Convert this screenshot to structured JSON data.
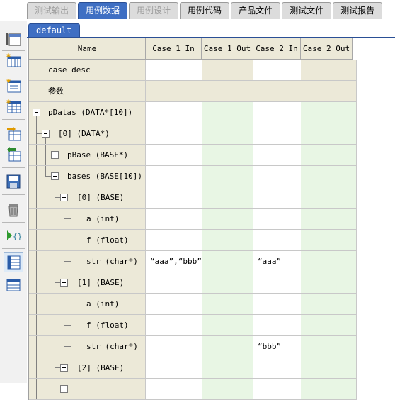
{
  "tabs": [
    {
      "label": "测试输出",
      "state": "disabled"
    },
    {
      "label": "用例数据",
      "state": "active"
    },
    {
      "label": "用例设计",
      "state": "disabled"
    },
    {
      "label": "用例代码",
      "state": "normal"
    },
    {
      "label": "产品文件",
      "state": "normal"
    },
    {
      "label": "测试文件",
      "state": "normal"
    },
    {
      "label": "测试报告",
      "state": "normal"
    }
  ],
  "toolbar": {
    "icons": [
      "new-window-icon",
      "new-table-icon",
      "new-list-icon",
      "new-grid-icon",
      "import-icon",
      "export-icon",
      "save-icon",
      "delete-icon",
      "run-code-icon",
      "row-view-icon",
      "column-view-icon"
    ]
  },
  "subtab": {
    "label": "default"
  },
  "grid": {
    "columns": [
      "Name",
      "Case 1 In",
      "Case 1 Out",
      "Case 2 In",
      "Case 2 Out"
    ],
    "rows": [
      {
        "name": "case desc",
        "values": [
          "",
          "",
          "",
          ""
        ]
      },
      {
        "name": "参数",
        "values": [
          "",
          "",
          "",
          ""
        ]
      },
      {
        "name": "pDatas (DATA*[10])",
        "values": [
          "",
          "",
          "",
          ""
        ]
      },
      {
        "name": "[0] (DATA*)",
        "values": [
          "",
          "",
          "",
          ""
        ]
      },
      {
        "name": "pBase (BASE*)",
        "values": [
          "",
          "",
          "",
          ""
        ]
      },
      {
        "name": "bases (BASE[10])",
        "values": [
          "",
          "",
          "",
          ""
        ]
      },
      {
        "name": "[0] (BASE)",
        "values": [
          "",
          "",
          "",
          ""
        ]
      },
      {
        "name": "a (int)",
        "values": [
          "",
          "",
          "",
          ""
        ]
      },
      {
        "name": "f (float)",
        "values": [
          "",
          "",
          "",
          ""
        ]
      },
      {
        "name": "str (char*)",
        "values": [
          "“aaa”,“bbb”",
          "",
          "“aaa”",
          ""
        ]
      },
      {
        "name": "[1] (BASE)",
        "values": [
          "",
          "",
          "",
          ""
        ]
      },
      {
        "name": "a (int)",
        "values": [
          "",
          "",
          "",
          ""
        ]
      },
      {
        "name": "f (float)",
        "values": [
          "",
          "",
          "",
          ""
        ]
      },
      {
        "name": "str (char*)",
        "values": [
          "",
          "",
          "“bbb”",
          ""
        ]
      },
      {
        "name": "[2] (BASE)",
        "values": [
          "",
          "",
          "",
          ""
        ]
      },
      {
        "name": "",
        "values": [
          "",
          "",
          "",
          ""
        ]
      }
    ]
  }
}
